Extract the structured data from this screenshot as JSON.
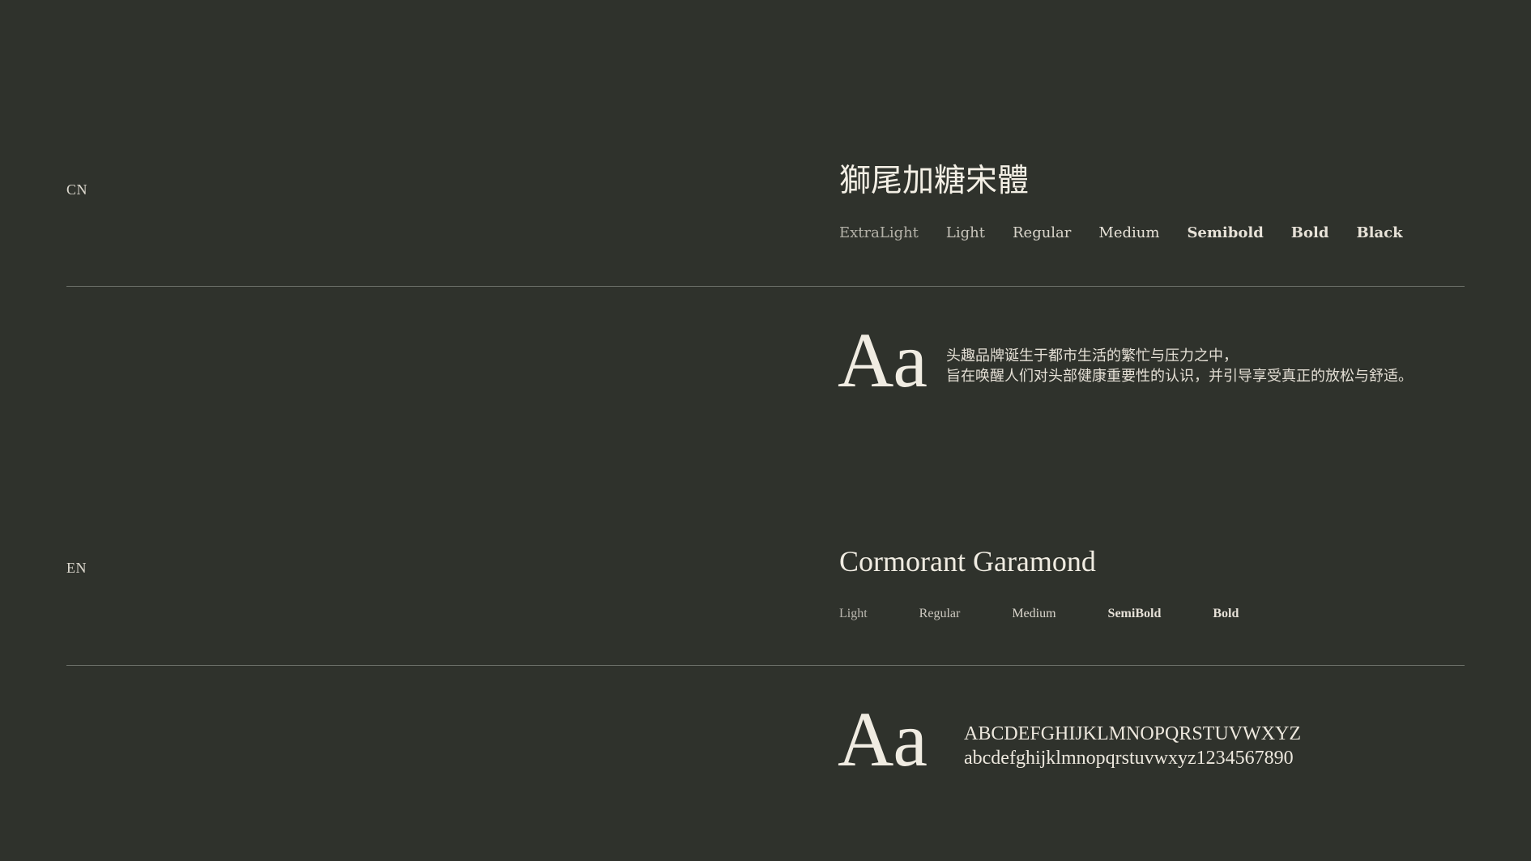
{
  "cn_section": {
    "label": "CN",
    "font_name": "獅尾加糖宋體",
    "weights": [
      "ExtraLight",
      "Light",
      "Regular",
      "Medium",
      "Semibold",
      "Bold",
      "Black"
    ],
    "specimen": "Aa",
    "sample_lines": [
      "头趣品牌诞生于都市生活的繁忙与压力之中，",
      "旨在唤醒人们对头部健康重要性的认识，并引导享受真正的放松与舒适。"
    ]
  },
  "en_section": {
    "label": "EN",
    "font_name": "Cormorant Garamond",
    "weights": [
      "Light",
      "Regular",
      "Medium",
      "SemiBold",
      "Bold"
    ],
    "specimen": "Aa",
    "sample_lines": [
      "ABCDEFGHIJKLMNOPQRSTUVWXYZ",
      "abcdefghijklmnopqrstuvwxyz1234567890"
    ]
  },
  "colors": {
    "background": "#2f322c",
    "text": "#ece8df",
    "divider": "#6d716a"
  }
}
